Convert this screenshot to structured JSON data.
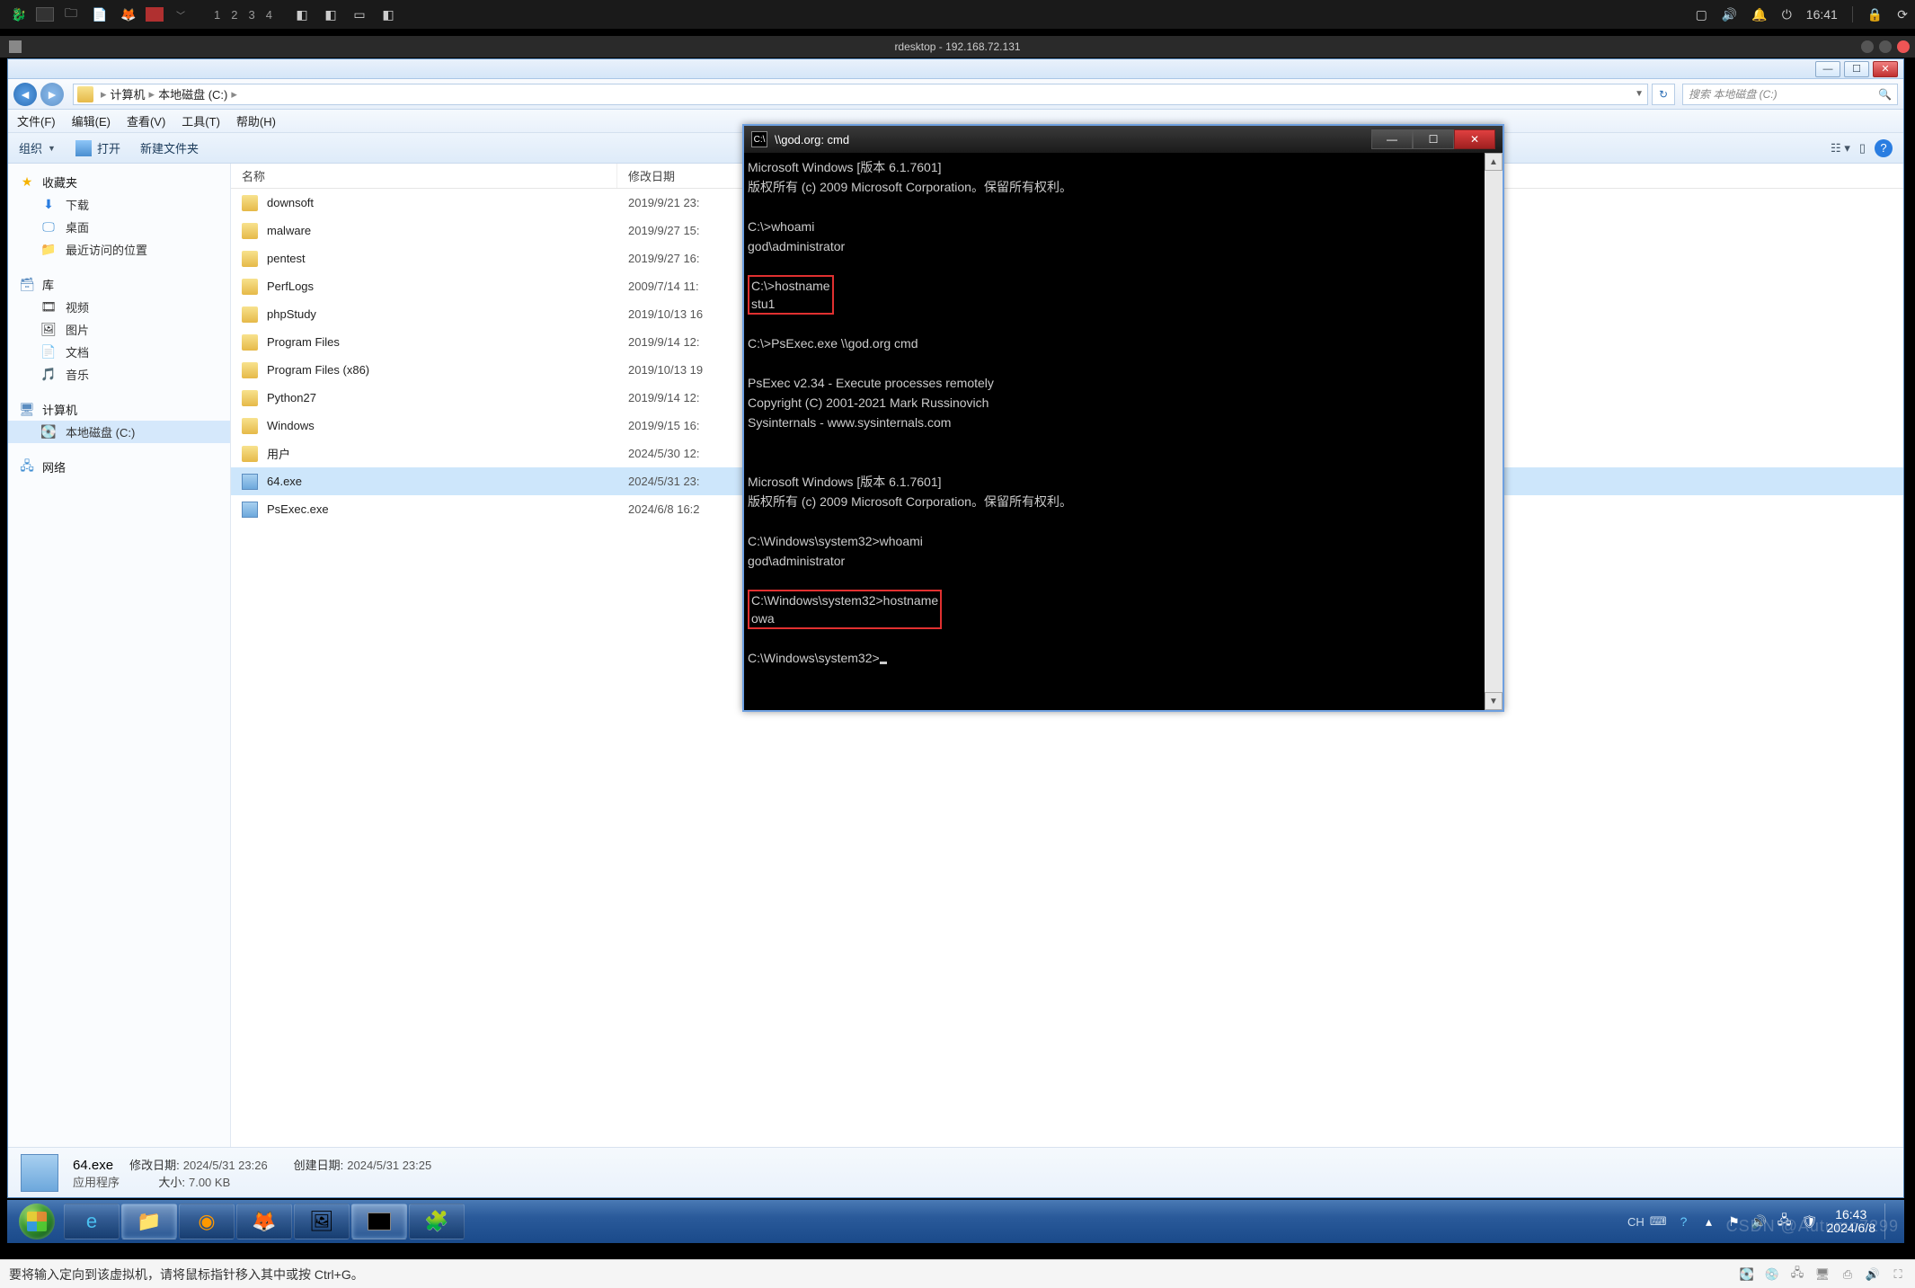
{
  "host_topbar": {
    "workspaces": [
      "1",
      "2",
      "3",
      "4"
    ],
    "time": "16:41"
  },
  "rdesktop": {
    "title": "rdesktop - 192.168.72.131"
  },
  "explorer": {
    "breadcrumb": {
      "root": "计算机",
      "path": "本地磁盘 (C:)"
    },
    "search_placeholder": "搜索 本地磁盘 (C:)",
    "menus": {
      "file": "文件(F)",
      "edit": "编辑(E)",
      "view": "查看(V)",
      "tools": "工具(T)",
      "help": "帮助(H)"
    },
    "toolbar": {
      "organize": "组织",
      "open": "打开",
      "newfolder": "新建文件夹"
    },
    "sidebar": {
      "favorites": "收藏夹",
      "downloads": "下载",
      "desktop": "桌面",
      "recent": "最近访问的位置",
      "libraries": "库",
      "videos": "视频",
      "pictures": "图片",
      "documents": "文档",
      "music": "音乐",
      "computer": "计算机",
      "local_c": "本地磁盘 (C:)",
      "network": "网络"
    },
    "columns": {
      "name": "名称",
      "date": "修改日期"
    },
    "files": [
      {
        "name": "downsoft",
        "type": "folder",
        "date": "2019/9/21 23:"
      },
      {
        "name": "malware",
        "type": "folder",
        "date": "2019/9/27 15:"
      },
      {
        "name": "pentest",
        "type": "folder",
        "date": "2019/9/27 16:"
      },
      {
        "name": "PerfLogs",
        "type": "folder",
        "date": "2009/7/14 11:"
      },
      {
        "name": "phpStudy",
        "type": "folder",
        "date": "2019/10/13 16"
      },
      {
        "name": "Program Files",
        "type": "folder",
        "date": "2019/9/14 12:"
      },
      {
        "name": "Program Files (x86)",
        "type": "folder",
        "date": "2019/10/13 19"
      },
      {
        "name": "Python27",
        "type": "folder",
        "date": "2019/9/14 12:"
      },
      {
        "name": "Windows",
        "type": "folder",
        "date": "2019/9/15 16:"
      },
      {
        "name": "用户",
        "type": "folder",
        "date": "2024/5/30 12:"
      },
      {
        "name": "64.exe",
        "type": "exe",
        "date": "2024/5/31 23:",
        "selected": true
      },
      {
        "name": "PsExec.exe",
        "type": "exe",
        "date": "2024/6/8 16:2"
      }
    ],
    "details": {
      "filename": "64.exe",
      "type": "应用程序",
      "mod_label": "修改日期:",
      "mod_value": "2024/5/31 23:26",
      "size_label": "大小:",
      "size_value": "7.00 KB",
      "create_label": "创建日期:",
      "create_value": "2024/5/31 23:25"
    }
  },
  "cmd": {
    "title": "\\\\god.org: cmd",
    "lines_a": "Microsoft Windows [版本 6.1.7601]\n版权所有 (c) 2009 Microsoft Corporation。保留所有权利。\n\nC:\\>whoami\ngod\\administrator\n",
    "box1": "C:\\>hostname\nstu1",
    "lines_b": "\nC:\\>PsExec.exe \\\\god.org cmd\n\nPsExec v2.34 - Execute processes remotely\nCopyright (C) 2001-2021 Mark Russinovich\nSysinternals - www.sysinternals.com\n\n\nMicrosoft Windows [版本 6.1.7601]\n版权所有 (c) 2009 Microsoft Corporation。保留所有权利。\n\nC:\\Windows\\system32>whoami\ngod\\administrator\n",
    "box2": "C:\\Windows\\system32>hostname\nowa",
    "lines_c": "\nC:\\Windows\\system32>"
  },
  "taskbar": {
    "lang": "CH",
    "time": "16:43",
    "date": "2024/6/8"
  },
  "host_status": {
    "text": "要将输入定向到该虚拟机，请将鼠标指针移入其中或按 Ctrl+G。",
    "watermark": "CSDN @Autumn7299"
  }
}
